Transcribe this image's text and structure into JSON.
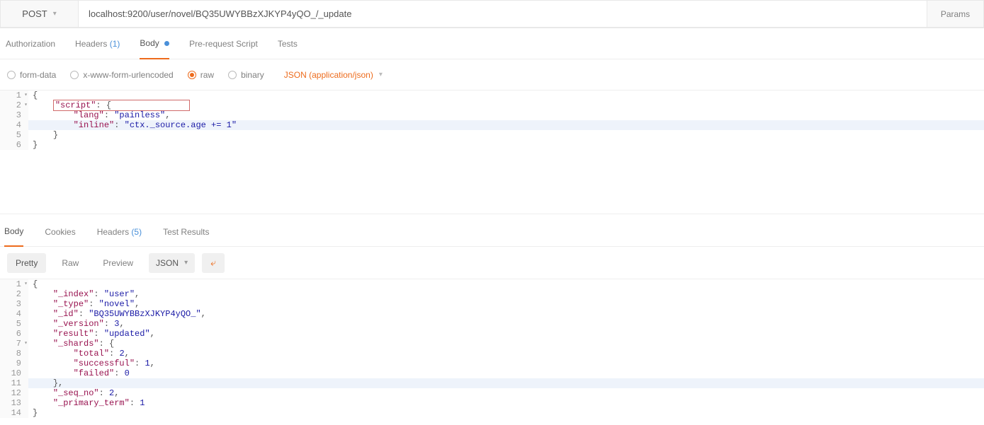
{
  "request": {
    "method": "POST",
    "url": "localhost:9200/user/novel/BQ35UWYBBzXJKYP4yQO_/_update",
    "paramsLabel": "Params"
  },
  "reqTabs": {
    "authorization": "Authorization",
    "headers": "Headers",
    "headersCount": "(1)",
    "body": "Body",
    "prerequest": "Pre-request Script",
    "tests": "Tests"
  },
  "bodyTypes": {
    "formdata": "form-data",
    "urlencoded": "x-www-form-urlencoded",
    "raw": "raw",
    "binary": "binary"
  },
  "contentType": "JSON (application/json)",
  "reqEditor": {
    "l1": {
      "p": "{"
    },
    "l2": {
      "k": "\"script\"",
      "c": ": ",
      "p": "{"
    },
    "l3": {
      "k": "\"lang\"",
      "c": ": ",
      "s": "\"painless\"",
      "t": ","
    },
    "l4": {
      "k": "\"inline\"",
      "c": ": ",
      "s": "\"ctx._source.age += 1\""
    },
    "l5": {
      "p": "}"
    },
    "l6": {
      "p": "}"
    }
  },
  "respTabs": {
    "body": "Body",
    "cookies": "Cookies",
    "headers": "Headers",
    "headersCount": "(5)",
    "testresults": "Test Results"
  },
  "viewModes": {
    "pretty": "Pretty",
    "raw": "Raw",
    "preview": "Preview",
    "format": "JSON"
  },
  "respEditor": {
    "l1": "{",
    "l2k": "\"_index\"",
    "l2s": "\"user\"",
    "l3k": "\"_type\"",
    "l3s": "\"novel\"",
    "l4k": "\"_id\"",
    "l4s": "\"BQ35UWYBBzXJKYP4yQO_\"",
    "l5k": "\"_version\"",
    "l5n": "3",
    "l6k": "\"result\"",
    "l6s": "\"updated\"",
    "l7k": "\"_shards\"",
    "l8k": "\"total\"",
    "l8n": "2",
    "l9k": "\"successful\"",
    "l9n": "1",
    "l10k": "\"failed\"",
    "l10n": "0",
    "l12k": "\"_seq_no\"",
    "l12n": "2",
    "l13k": "\"_primary_term\"",
    "l13n": "1"
  }
}
